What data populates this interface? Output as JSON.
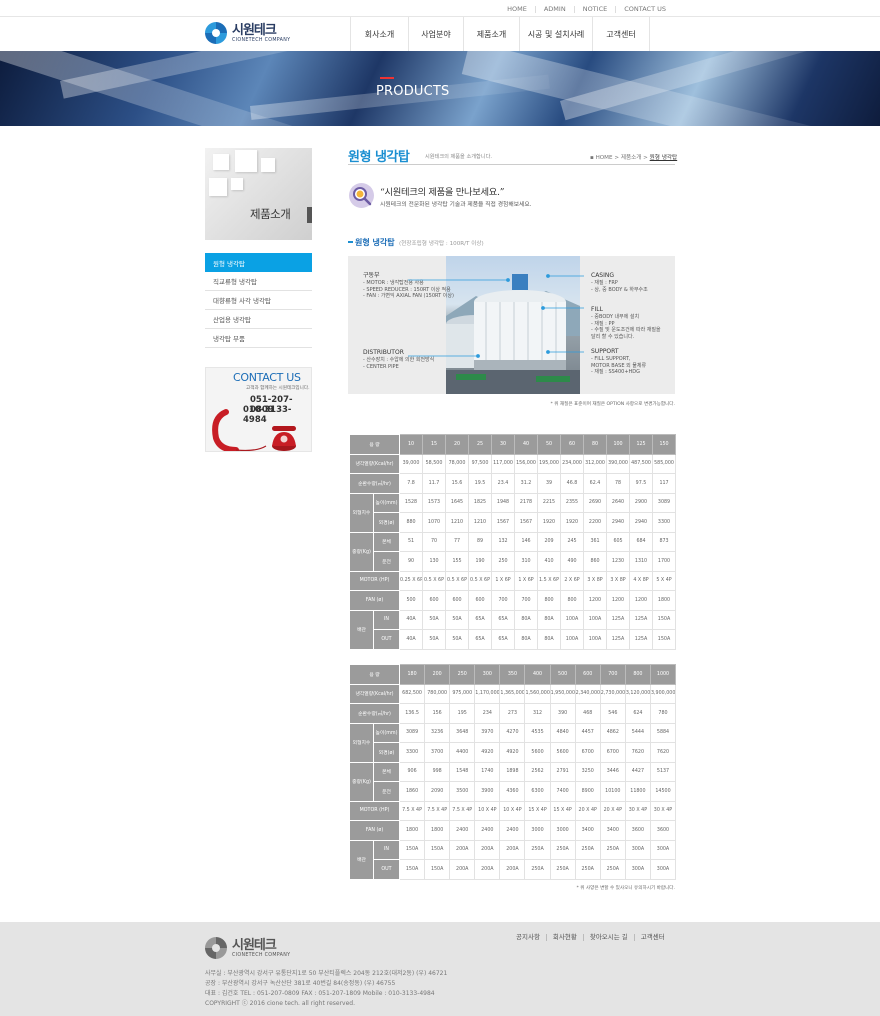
{
  "util_nav": [
    "HOME",
    "ADMIN",
    "NOTICE",
    "CONTACT US"
  ],
  "logo": {
    "ko": "시원테크",
    "en": "CIONETECH COMPANY"
  },
  "gnb": [
    "회사소개",
    "사업분야",
    "제품소개",
    "시공 및 설치사례",
    "고객센터"
  ],
  "banner": {
    "title": "PRODUCTS"
  },
  "side": {
    "title": "제품소개",
    "items": [
      "원형 냉각탑",
      "직교류형 냉각탑",
      "대향류형 사각 냉각탑",
      "산업용 냉각탑",
      "냉각탑 부품"
    ],
    "active_index": 0
  },
  "contact": {
    "title": "CONTACT US",
    "sub": "고객과 함께하는 시원테크입니다.",
    "phone1": "051-207-0809",
    "phone2": "010-3133-4984"
  },
  "content": {
    "title": "원형 냉각탑",
    "subtitle": "시원테크의 제품을 소개합니다.",
    "breadcrumb": [
      "HOME",
      "제품소개",
      "원형 냉각탑"
    ],
    "quote": "“시원테크의 제품을 만나보세요.”",
    "quote_sub": "시원테크의 전문화된 냉각탑 기술과 제품을 직접 경험해보세요.",
    "section_title": "원형 냉각탑",
    "section_sub": "(현장조립형 냉각탑 : 100R/T 이상)"
  },
  "diagram": {
    "drive": {
      "title": "구동부",
      "lines": [
        "- MOTOR : 냉각탑전용 사용",
        "- SPEED REDUCER : 150RT 이상 적용",
        "- FAN : 가변익 AXIAL FAN (150RT 이상)"
      ]
    },
    "distributor": {
      "title": "DISTRIBUTOR",
      "lines": [
        "- 산수장치 : 수압에 의한 회전방식",
        "- CENTER PIPE"
      ]
    },
    "casing": {
      "title": "CASING",
      "lines": [
        "- 재질 : FRP",
        "- 상, 중 BODY & 하부수조"
      ]
    },
    "fill": {
      "title": "FILL",
      "lines": [
        "- 중BODY 내부에 설치",
        "- 재질 : PP",
        "- 수질 및 운도조건에 따라 재질을",
        "  달리 할 수 있습니다."
      ]
    },
    "support": {
      "title": "SUPPORT",
      "lines": [
        "- FILL SUPPORT,",
        "  MOTOR BASE 외 물체류",
        "- 재질 : SS400+HDG"
      ]
    },
    "note": "* 위 재질은 표준이며 재질은 OPTION 사항으로 변경가능합니다."
  },
  "labels": {
    "model": "용 량",
    "capacity": "냉각열량(Kcal/hr)",
    "flow": "순환수량(㎥/hr)",
    "dims": "외형치수",
    "height": "높이(mm)",
    "diameter": "외경(ø)",
    "weight": "중량(Kg)",
    "body": "본체",
    "operating": "운전",
    "motor": "MOTOR (HP)",
    "fan": "FAN (ø)",
    "piping": "배관",
    "in": "IN",
    "out": "OUT"
  },
  "table1": {
    "models": [
      "10",
      "15",
      "20",
      "25",
      "30",
      "40",
      "50",
      "60",
      "80",
      "100",
      "125",
      "150"
    ],
    "capacity": [
      "39,000",
      "58,500",
      "78,000",
      "97,500",
      "117,000",
      "156,000",
      "195,000",
      "234,000",
      "312,000",
      "390,000",
      "487,500",
      "585,000"
    ],
    "flow": [
      "7.8",
      "11.7",
      "15.6",
      "19.5",
      "23.4",
      "31.2",
      "39",
      "46.8",
      "62.4",
      "78",
      "97.5",
      "117"
    ],
    "height": [
      "1528",
      "1573",
      "1645",
      "1825",
      "1948",
      "2178",
      "2215",
      "2355",
      "2690",
      "2640",
      "2900",
      "3089"
    ],
    "diameter": [
      "880",
      "1070",
      "1210",
      "1210",
      "1567",
      "1567",
      "1920",
      "1920",
      "2200",
      "2940",
      "2940",
      "3300"
    ],
    "body": [
      "51",
      "70",
      "77",
      "89",
      "132",
      "146",
      "209",
      "245",
      "361",
      "605",
      "684",
      "873"
    ],
    "operating": [
      "90",
      "130",
      "155",
      "190",
      "250",
      "310",
      "410",
      "490",
      "860",
      "1230",
      "1310",
      "1700"
    ],
    "motor": [
      "0.25 X 6P",
      "0.5 X 6P",
      "0.5 X 6P",
      "0.5 X 6P",
      "1 X 6P",
      "1 X 6P",
      "1.5 X 6P",
      "2 X 6P",
      "3 X 8P",
      "3 X 8P",
      "4 X 8P",
      "5 X 4P"
    ],
    "fan": [
      "500",
      "600",
      "600",
      "600",
      "700",
      "700",
      "800",
      "800",
      "1200",
      "1200",
      "1200",
      "1800"
    ],
    "in": [
      "40A",
      "50A",
      "50A",
      "65A",
      "65A",
      "80A",
      "80A",
      "100A",
      "100A",
      "125A",
      "125A",
      "150A"
    ],
    "out": [
      "40A",
      "50A",
      "50A",
      "65A",
      "65A",
      "80A",
      "80A",
      "100A",
      "100A",
      "125A",
      "125A",
      "150A"
    ]
  },
  "table2": {
    "models": [
      "180",
      "200",
      "250",
      "300",
      "350",
      "400",
      "500",
      "600",
      "700",
      "800",
      "1000"
    ],
    "capacity": [
      "682,500",
      "780,000",
      "975,000",
      "1,170,000",
      "1,365,000",
      "1,560,000",
      "1,950,000",
      "2,340,000",
      "2,730,000",
      "3,120,000",
      "3,900,000"
    ],
    "flow": [
      "136.5",
      "156",
      "195",
      "234",
      "273",
      "312",
      "390",
      "468",
      "546",
      "624",
      "780"
    ],
    "height": [
      "3089",
      "3236",
      "3648",
      "3970",
      "4270",
      "4535",
      "4840",
      "4457",
      "4862",
      "5444",
      "5884"
    ],
    "diameter": [
      "3300",
      "3700",
      "4400",
      "4920",
      "4920",
      "5600",
      "5600",
      "6700",
      "6700",
      "7620",
      "7620"
    ],
    "body": [
      "906",
      "998",
      "1548",
      "1740",
      "1898",
      "2562",
      "2791",
      "3250",
      "3446",
      "4427",
      "5137"
    ],
    "operating": [
      "1860",
      "2090",
      "3500",
      "3900",
      "4360",
      "6300",
      "7400",
      "8900",
      "10100",
      "11800",
      "14500"
    ],
    "motor": [
      "7.5 X 4P",
      "7.5 X 4P",
      "7.5 X 4P",
      "10 X 4P",
      "10 X 4P",
      "15 X 4P",
      "15 X 4P",
      "20 X 4P",
      "20 X 4P",
      "30 X 4P",
      "30 X 4P"
    ],
    "fan": [
      "1800",
      "1800",
      "2400",
      "2400",
      "2400",
      "3000",
      "3000",
      "3400",
      "3400",
      "3600",
      "3600"
    ],
    "in": [
      "150A",
      "150A",
      "200A",
      "200A",
      "200A",
      "250A",
      "250A",
      "250A",
      "250A",
      "300A",
      "300A"
    ],
    "out": [
      "150A",
      "150A",
      "200A",
      "200A",
      "200A",
      "250A",
      "250A",
      "250A",
      "250A",
      "300A",
      "300A"
    ]
  },
  "table_note": "* 위 사양은 변할 수 있사오니 유의하시기 바랍니다.",
  "footer": {
    "nav": [
      "공지사항",
      "회사현황",
      "찾아오시는 길",
      "고객센터"
    ],
    "info": [
      "사무실 : 부산광역시 강서구 유통단지1로 50 부산티플렉스 204동 212호(대저2동) (우) 46721",
      "공장 : 부산광역시 강서구 녹산산단 381로 40번길 84(송정동) (우) 46755",
      "대표 : 김건호 TEL : 051-207-0809 FAX : 051-207-1809 Mobile : 010-3133-4984",
      "COPYRIGHT ⓒ 2016 cione tech. all right reserved."
    ]
  }
}
